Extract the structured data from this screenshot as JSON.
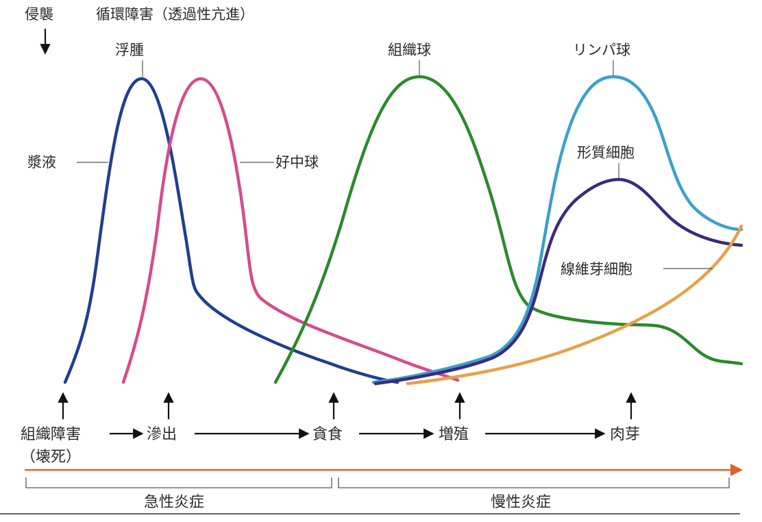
{
  "header": {
    "invasion_label": "侵襲",
    "circulation_label": "循環障害（透過性亢進）"
  },
  "curves": {
    "edema": "浮腫",
    "plasma": "漿液",
    "neutrophil": "好中球",
    "histiocyte": "組織球",
    "lymphocyte": "リンパ球",
    "plasma_cell": "形質細胞",
    "fibroblast": "線維芽細胞"
  },
  "stages": {
    "tissue_damage": "組織障害",
    "necrosis": "（壊死）",
    "exudation": "滲出",
    "phagocytosis": "貪食",
    "proliferation": "増殖",
    "granulation": "肉芽"
  },
  "phases": {
    "acute": "急性炎症",
    "chronic": "慢性炎症"
  },
  "colors": {
    "plasma_curve": "#1f3f8f",
    "neutrophil_curve": "#d64b8c",
    "histiocyte_curve": "#2a8a2a",
    "lymphocyte_curve": "#3aa0cc",
    "plasma_cell_curve": "#3d2a7a",
    "fibroblast_curve": "#e8a048",
    "timeline": "#e0602a"
  }
}
